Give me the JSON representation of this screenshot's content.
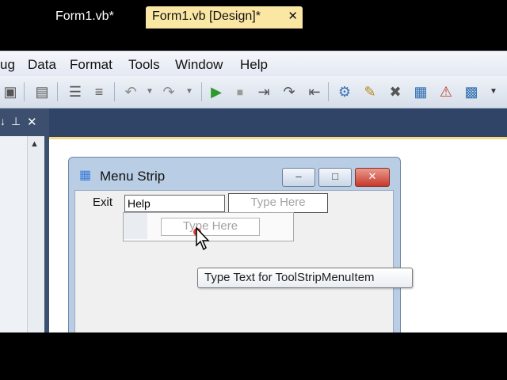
{
  "menubar": {
    "items": [
      "ug",
      "Data",
      "Format",
      "Tools",
      "Window",
      "Help"
    ]
  },
  "toolbar": {
    "icons": [
      "paste-icon",
      "find-icon",
      "align-icon",
      "format-icon",
      "undo-icon",
      "undo-dropdown-icon",
      "redo-icon",
      "redo-dropdown-icon",
      "start-debug-icon",
      "stop-icon",
      "step-into-icon",
      "step-over-icon",
      "step-out-icon",
      "solution-explorer-icon",
      "properties-icon",
      "toolbox-icon",
      "class-view-icon",
      "error-list-icon",
      "output-icon",
      "toolbar-overflow-icon"
    ]
  },
  "left_panel": {
    "pin_glyph": "↓",
    "pin2_glyph": "⊥",
    "close_glyph": "✕",
    "scroll_up_glyph": "▲"
  },
  "tabs": [
    {
      "label": "Form1.vb*",
      "active": false
    },
    {
      "label": "Form1.vb [Design]*",
      "active": true,
      "close_glyph": "✕"
    }
  ],
  "form": {
    "title": "Menu Strip",
    "min_glyph": "–",
    "max_glyph": "□",
    "close_glyph": "✕",
    "menu_strip": {
      "exit_label": "Exit",
      "edit_value": "Help",
      "type_here_right": "Type Here",
      "type_here_below": "Type Here"
    }
  },
  "tooltip": {
    "text": "Type Text for ToolStripMenuItem"
  },
  "colors": {
    "tab_bg": "#2f4466",
    "active_tab": "#fbe7a4",
    "form_border": "#b9cde4",
    "close_button": "#d9534f"
  }
}
